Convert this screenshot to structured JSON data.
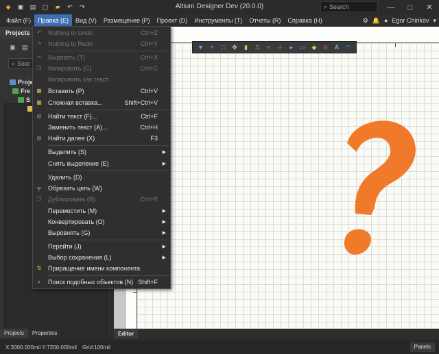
{
  "window": {
    "title": "Altium Designer Dev (20.0.0)",
    "search_placeholder": "Search",
    "minimize_glyph": "—",
    "maximize_glyph": "□",
    "close_glyph": "✕"
  },
  "menubar": {
    "items": [
      {
        "label": "Файл (F)"
      },
      {
        "label": "Правка (E)"
      },
      {
        "label": "Вид (V)"
      },
      {
        "label": "Размещение (P)"
      },
      {
        "label": "Проект (D)"
      },
      {
        "label": "Инструменты (T)"
      },
      {
        "label": "Отчеты (R)"
      },
      {
        "label": "Справка (H)"
      }
    ],
    "user": "Egor Chirikov"
  },
  "left_panel": {
    "title": "Projects",
    "search_placeholder": "Sear",
    "tree": [
      {
        "label": "Proje"
      },
      {
        "label": "Fre"
      },
      {
        "label": "S"
      }
    ],
    "tabs": [
      "Projects",
      "Properties"
    ]
  },
  "editor": {
    "tab": "Editor"
  },
  "status": {
    "coords": "X:3000.000mil Y:7200.000mil",
    "grid": "Grid:100mil",
    "panels": "Panels"
  },
  "dropdown": {
    "items": [
      {
        "label": "Nothing to Undo",
        "shortcut": "Ctrl+Z",
        "enabled": false,
        "icon": "undo-icon"
      },
      {
        "label": "Nothing to Redo",
        "shortcut": "Ctrl+Y",
        "enabled": false,
        "icon": "redo-icon"
      },
      {
        "label": "Вырезать (T)",
        "shortcut": "Ctrl+X",
        "enabled": false,
        "icon": "cut-icon"
      },
      {
        "label": "Копировать (C)",
        "shortcut": "Ctrl+C",
        "enabled": false,
        "icon": "copy-icon"
      },
      {
        "label": "Копировать как текст",
        "shortcut": "",
        "enabled": false,
        "icon": ""
      },
      {
        "label": "Вставить (P)",
        "shortcut": "Ctrl+V",
        "enabled": true,
        "icon": "paste-icon"
      },
      {
        "label": "Сложная вставка...",
        "shortcut": "Shift+Ctrl+V",
        "enabled": true,
        "icon": "paste-special-icon"
      },
      {
        "label": "Найти текст (F)...",
        "shortcut": "Ctrl+F",
        "enabled": true,
        "icon": "binoculars-icon"
      },
      {
        "label": "Заменить текст (A)...",
        "shortcut": "Ctrl+H",
        "enabled": true,
        "icon": ""
      },
      {
        "label": "Найти далее (X)",
        "shortcut": "F3",
        "enabled": true,
        "icon": "find-next-icon"
      },
      {
        "label": "Выделить (S)",
        "shortcut": "",
        "enabled": true,
        "icon": "",
        "submenu": true
      },
      {
        "label": "Снять выделение (E)",
        "shortcut": "",
        "enabled": true,
        "icon": "",
        "submenu": true
      },
      {
        "label": "Удалить (D)",
        "shortcut": "",
        "enabled": true,
        "icon": ""
      },
      {
        "label": "Обрезать цепь (W)",
        "shortcut": "",
        "enabled": true,
        "icon": "break-wire-icon"
      },
      {
        "label": "Дублировать (B)",
        "shortcut": "Ctrl+R",
        "enabled": false,
        "icon": "duplicate-icon"
      },
      {
        "label": "Переместить (M)",
        "shortcut": "",
        "enabled": true,
        "icon": "",
        "submenu": true
      },
      {
        "label": "Конвертировать (O)",
        "shortcut": "",
        "enabled": true,
        "icon": "",
        "submenu": true
      },
      {
        "label": "Выровнять (G)",
        "shortcut": "",
        "enabled": true,
        "icon": "",
        "submenu": true
      },
      {
        "label": "Перейти (J)",
        "shortcut": "",
        "enabled": true,
        "icon": "",
        "submenu": true
      },
      {
        "label": "Выбор сохранения (L)",
        "shortcut": "",
        "enabled": true,
        "icon": "",
        "submenu": true
      },
      {
        "label": "Приращение имени компонента",
        "shortcut": "",
        "enabled": true,
        "icon": "increment-icon"
      },
      {
        "label": "Поиск подобных объектов (N)",
        "shortcut": "Shift+F",
        "enabled": true,
        "icon": "find-similar-icon"
      }
    ]
  },
  "colors": {
    "accent": "#3f6fb0",
    "question_mark": "#f07a2a"
  }
}
